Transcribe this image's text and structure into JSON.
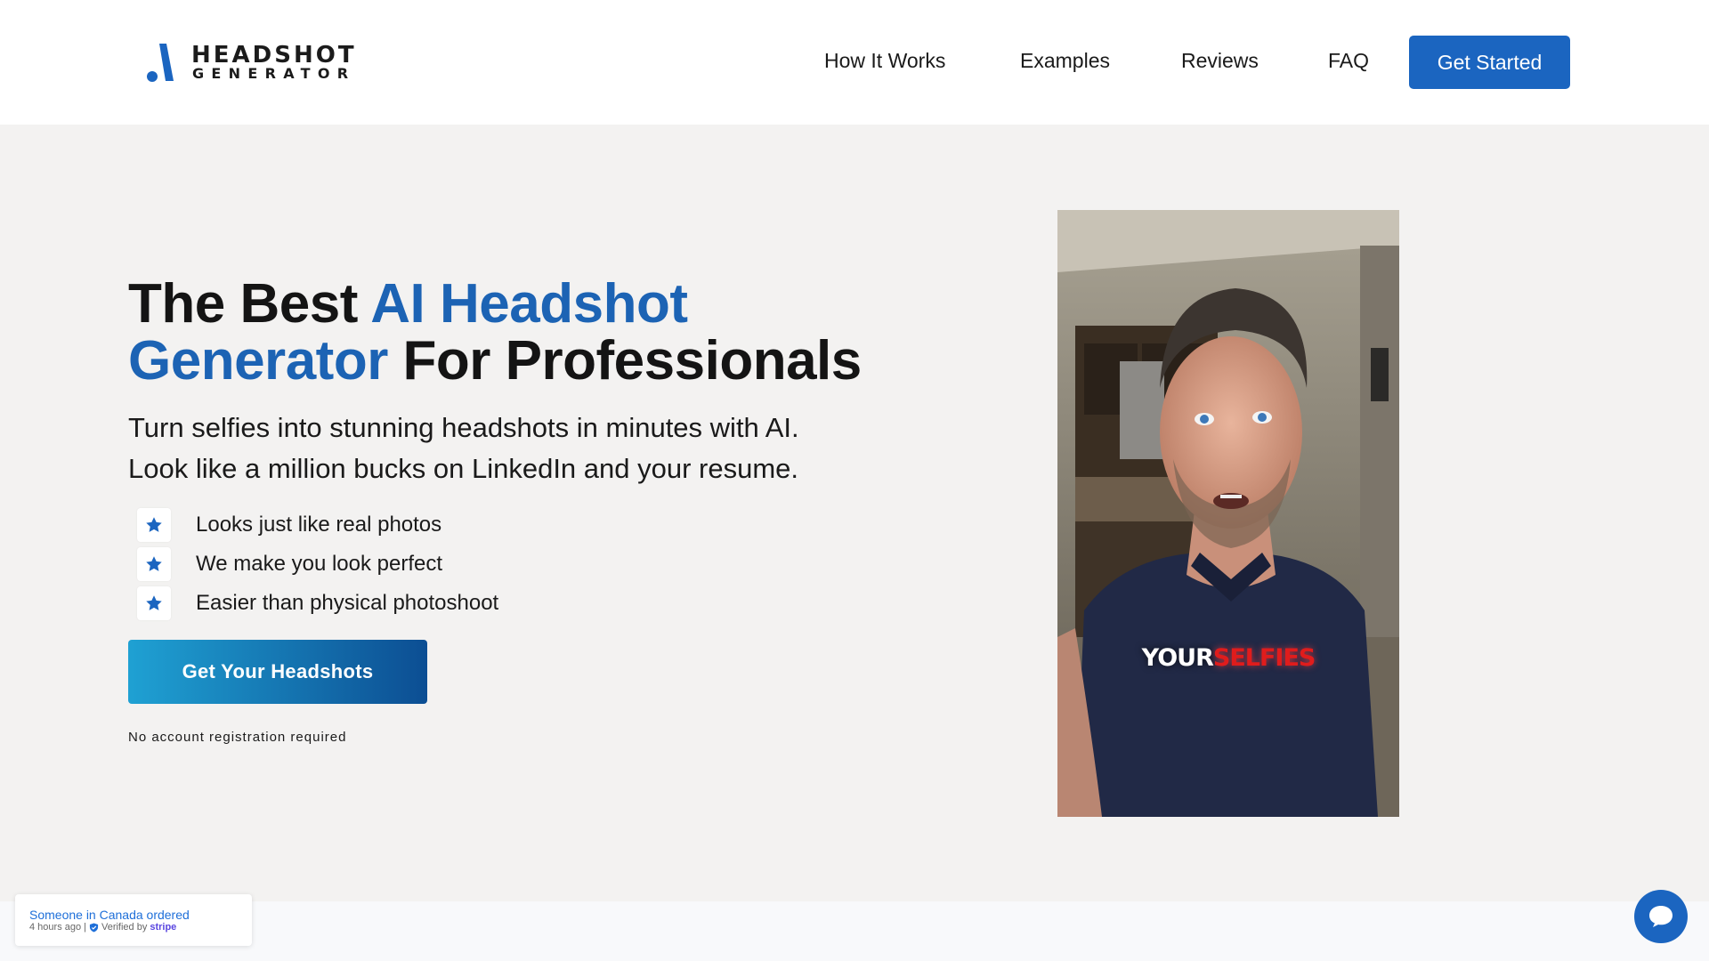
{
  "brand": {
    "line1": "HEADSHOT",
    "line2": "GENERATOR",
    "accent_color": "#1b65c0"
  },
  "nav": {
    "items": [
      {
        "label": "How It Works"
      },
      {
        "label": "Examples"
      },
      {
        "label": "Reviews"
      },
      {
        "label": "FAQ"
      }
    ],
    "cta_label": "Get Started"
  },
  "hero": {
    "title_part1": "The Best ",
    "title_accent": "AI Headshot Generator",
    "title_part2": " For Professionals",
    "subtitle_line1": "Turn selfies into stunning headshots in minutes with AI.",
    "subtitle_line2": "Look like a million bucks on LinkedIn and your resume.",
    "features": [
      {
        "icon": "star-icon",
        "text": "Looks just like real photos"
      },
      {
        "icon": "star-icon",
        "text": "We make you look perfect"
      },
      {
        "icon": "star-icon",
        "text": "Easier than physical photoshoot"
      }
    ],
    "cta_label": "Get Your Headshots",
    "note": "No account registration required"
  },
  "video": {
    "caption_word1": "YOUR",
    "caption_word2": "SELFIES"
  },
  "notification": {
    "message": "Someone in Canada ordered",
    "time": "4 hours ago",
    "verified_text": "Verified by",
    "provider": "stripe"
  },
  "chat": {
    "icon": "chat-bubble-icon"
  }
}
